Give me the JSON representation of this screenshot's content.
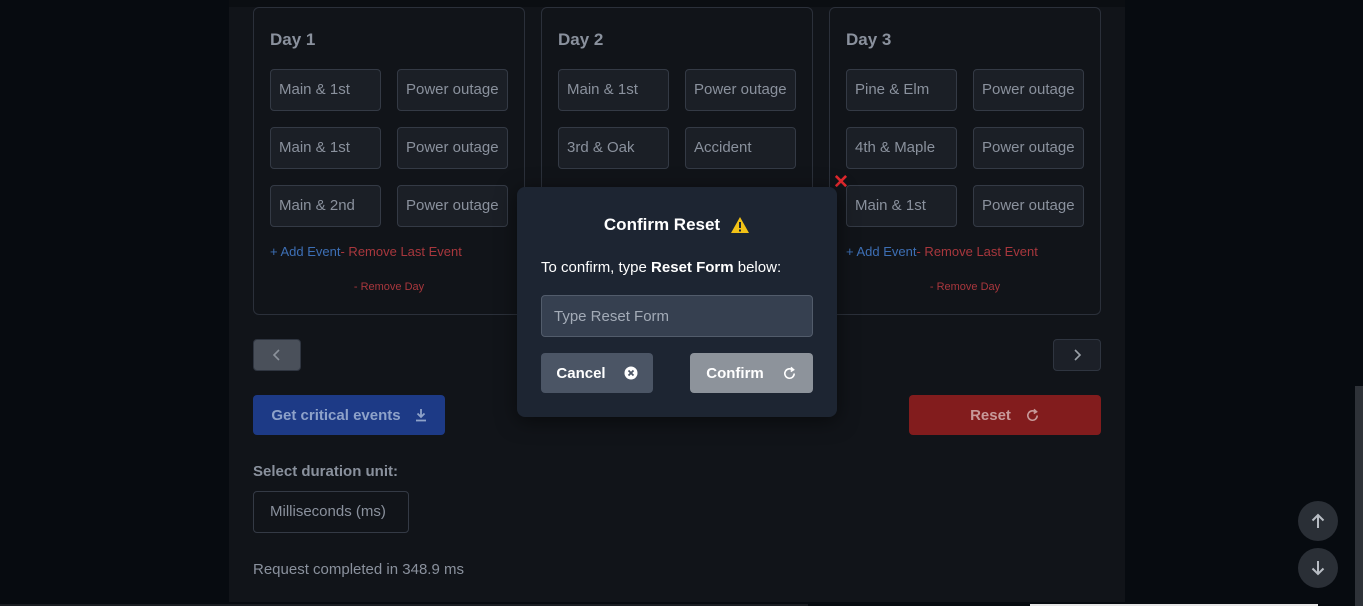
{
  "days": [
    {
      "title": "Day 1",
      "events": [
        {
          "location": "Main & 1st",
          "type": "Power outage"
        },
        {
          "location": "Main & 1st",
          "type": "Power outage"
        },
        {
          "location": "Main & 2nd",
          "type": "Power outage"
        }
      ],
      "add_event": "+ Add Event",
      "remove_last": "- Remove Last Event",
      "remove_day": "- Remove Day"
    },
    {
      "title": "Day 2",
      "events": [
        {
          "location": "Main & 1st",
          "type": "Power outage"
        },
        {
          "location": "3rd & Oak",
          "type": "Accident"
        }
      ]
    },
    {
      "title": "Day 3",
      "events": [
        {
          "location": "Pine & Elm",
          "type": "Power outage"
        },
        {
          "location": "4th & Maple",
          "type": "Power outage"
        },
        {
          "location": "Main & 1st",
          "type": "Power outage"
        }
      ],
      "add_event": "+ Add Event",
      "remove_last": "- Remove Last Event",
      "remove_day": "- Remove Day"
    }
  ],
  "actions": {
    "critical_label": "Get critical events",
    "reset_label": "Reset"
  },
  "duration": {
    "label": "Select duration unit:",
    "selected": "Milliseconds (ms)"
  },
  "status": "Request completed in 348.9 ms",
  "modal": {
    "title": "Confirm Reset",
    "text_prefix": "To confirm, type ",
    "text_keyword": "Reset Form",
    "text_suffix": " below:",
    "input_placeholder": "Type Reset Form",
    "cancel_label": "Cancel",
    "confirm_label": "Confirm"
  },
  "colors": {
    "close": "#e0282d",
    "warning": "#f2c216",
    "primary": "#1d3a86",
    "danger": "#821c1d"
  },
  "icons": {
    "warning": "warning-icon",
    "close": "close-icon",
    "download": "download-icon",
    "refresh": "refresh-icon",
    "cancel": "circle-x-icon",
    "up": "arrow-up-icon",
    "down": "arrow-down-icon",
    "prev": "chevron-left-icon",
    "next": "chevron-right-icon"
  }
}
